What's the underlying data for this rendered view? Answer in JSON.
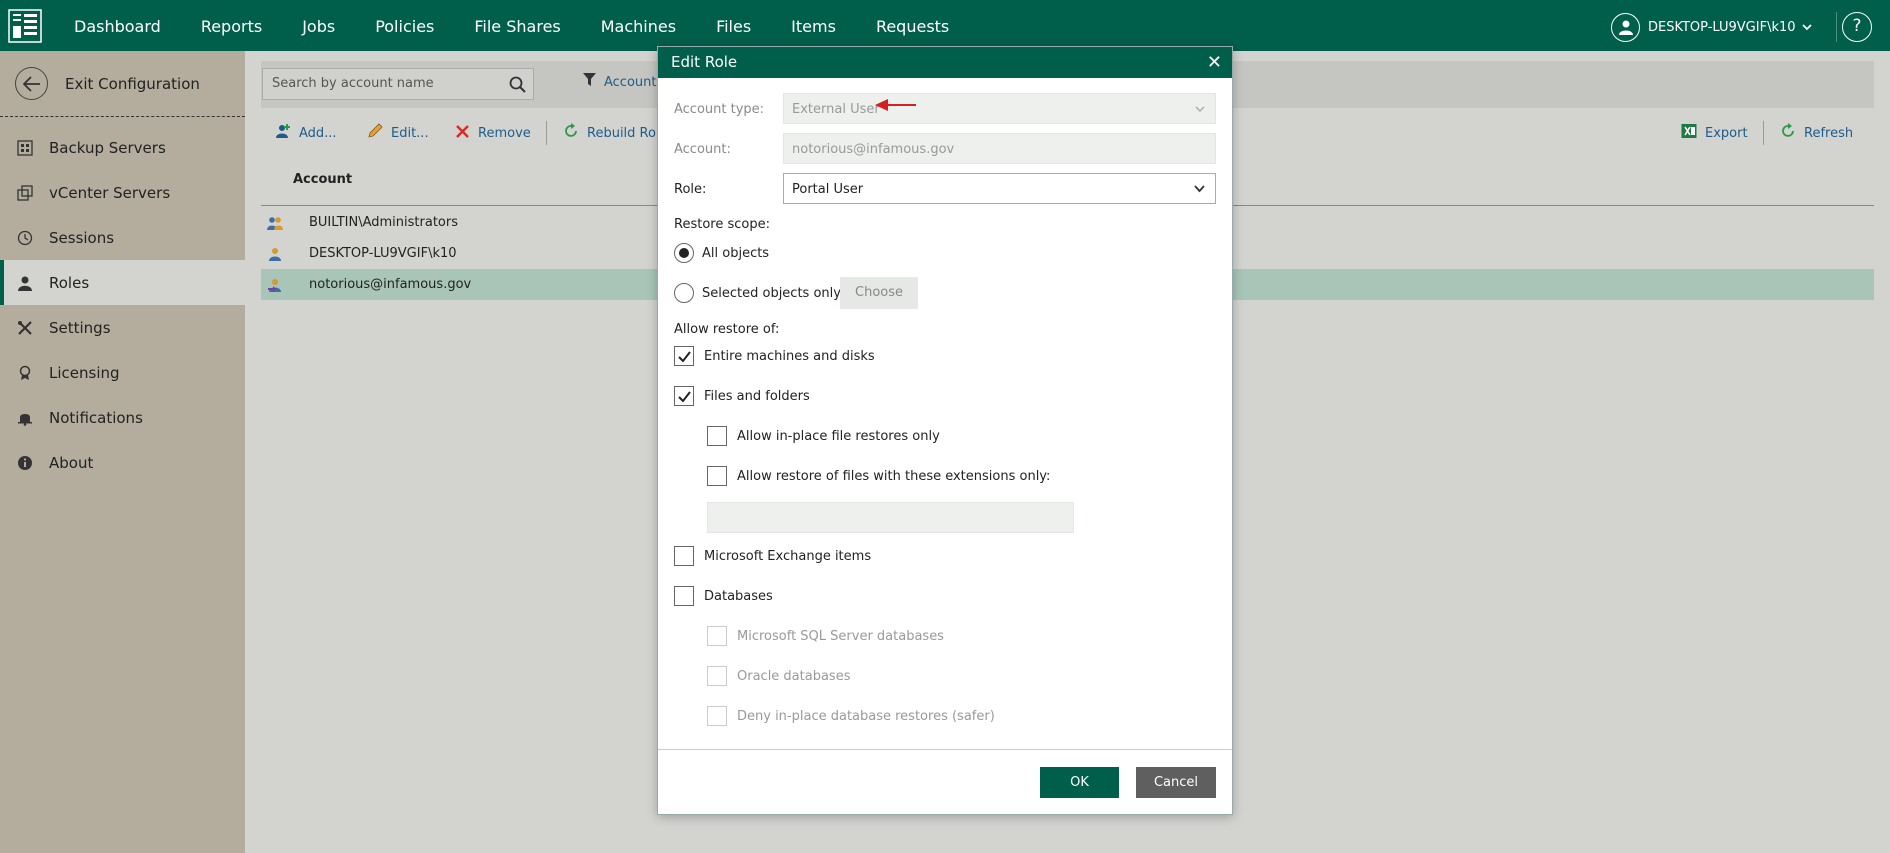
{
  "nav": {
    "items": [
      "Dashboard",
      "Reports",
      "Jobs",
      "Policies",
      "File Shares",
      "Machines",
      "Files",
      "Items",
      "Requests"
    ],
    "user": "DESKTOP-LU9VGIF\\k10",
    "help": "?"
  },
  "sidebar": {
    "exit_label": "Exit Configuration",
    "items": [
      {
        "label": "Backup Servers",
        "icon": "backup-servers-icon"
      },
      {
        "label": "vCenter Servers",
        "icon": "vcenter-icon"
      },
      {
        "label": "Sessions",
        "icon": "clock-icon"
      },
      {
        "label": "Roles",
        "icon": "person-icon"
      },
      {
        "label": "Settings",
        "icon": "wrench-icon"
      },
      {
        "label": "Licensing",
        "icon": "license-icon"
      },
      {
        "label": "Notifications",
        "icon": "bell-icon"
      },
      {
        "label": "About",
        "icon": "info-icon"
      }
    ],
    "active": "Roles"
  },
  "main": {
    "search_placeholder": "Search by account name",
    "filter_label": "Account",
    "toolbar": {
      "add": "Add...",
      "edit": "Edit...",
      "remove": "Remove",
      "rebuild": "Rebuild Rol",
      "export": "Export",
      "refresh": "Refresh"
    },
    "column_account": "Account",
    "rows": [
      "BUILTIN\\Administrators",
      "DESKTOP-LU9VGIF\\k10",
      "notorious@infamous.gov"
    ]
  },
  "modal": {
    "title": "Edit Role",
    "close": "✕",
    "account_type_label": "Account type:",
    "account_type_value": "External User",
    "account_label": "Account:",
    "account_value": "notorious@infamous.gov",
    "role_label": "Role:",
    "role_value": "Portal User",
    "restore_scope_label": "Restore scope:",
    "all_objects": "All objects",
    "selected_objects": "Selected objects only",
    "choose": "Choose",
    "allow_restore_label": "Allow restore of:",
    "entire_machines": "Entire machines and disks",
    "files_folders": "Files and folders",
    "in_place_files": "Allow in-place file restores only",
    "extensions_only": "Allow restore of files with these extensions only:",
    "exchange": "Microsoft Exchange items",
    "databases": "Databases",
    "sql": "Microsoft SQL Server databases",
    "oracle": "Oracle databases",
    "deny_in_place": "Deny in-place database restores (safer)",
    "ok": "OK",
    "cancel": "Cancel"
  },
  "colors": {
    "brand": "#005f4b",
    "sidebar": "#b4ad9e",
    "selected_row": "#a8c5b8",
    "link": "#1f5c8a",
    "annotation_arrow": "#d81f1f"
  }
}
